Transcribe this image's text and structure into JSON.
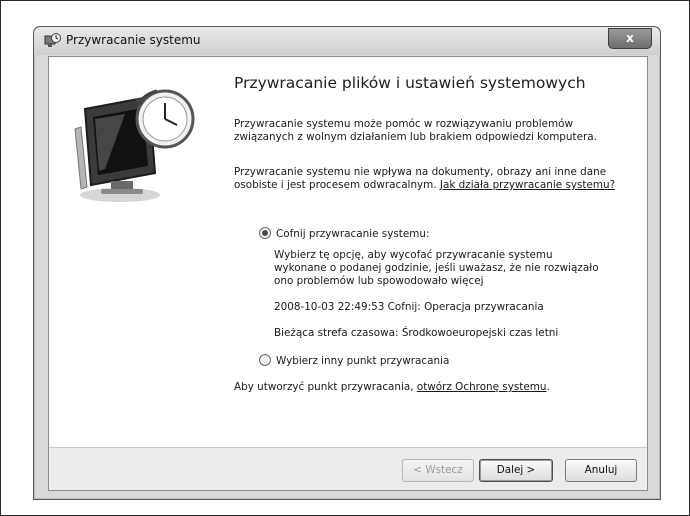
{
  "window": {
    "title": "Przywracanie systemu",
    "close_label": "x"
  },
  "main": {
    "heading": "Przywracanie plików i ustawień systemowych",
    "intro": "Przywracanie systemu może pomóc w rozwiązywaniu problemów związanych z wolnym działaniem lub brakiem odpowiedzi komputera.",
    "info_text": "Przywracanie systemu nie wpływa na dokumenty, obrazy ani inne dane osobiste i jest procesem odwracalnym. ",
    "info_link": "Jak działa przywracanie systemu?",
    "options": [
      {
        "label": "Cofnij przywracanie systemu:",
        "checked": true,
        "description": "Wybierz tę opcję, aby wycofać przywracanie systemu wykonane o podanej godzinie, jeśli uważasz, że nie rozwiązało ono problemów lub spowodowało więcej",
        "restore_entry": "2008-10-03 22:49:53 Cofnij: Operacja przywracania",
        "timezone": "Bieżąca strefa czasowa: Środkowoeuropejski czas letni"
      },
      {
        "label": "Wybierz inny punkt przywracania",
        "checked": false
      }
    ],
    "create_text": "Aby utworzyć punkt przywracania, ",
    "create_link": "otwórz Ochronę systemu",
    "create_suffix": "."
  },
  "footer": {
    "back_label": "< Wstecz",
    "next_label": "Dalej >",
    "cancel_label": "Anuluj"
  }
}
